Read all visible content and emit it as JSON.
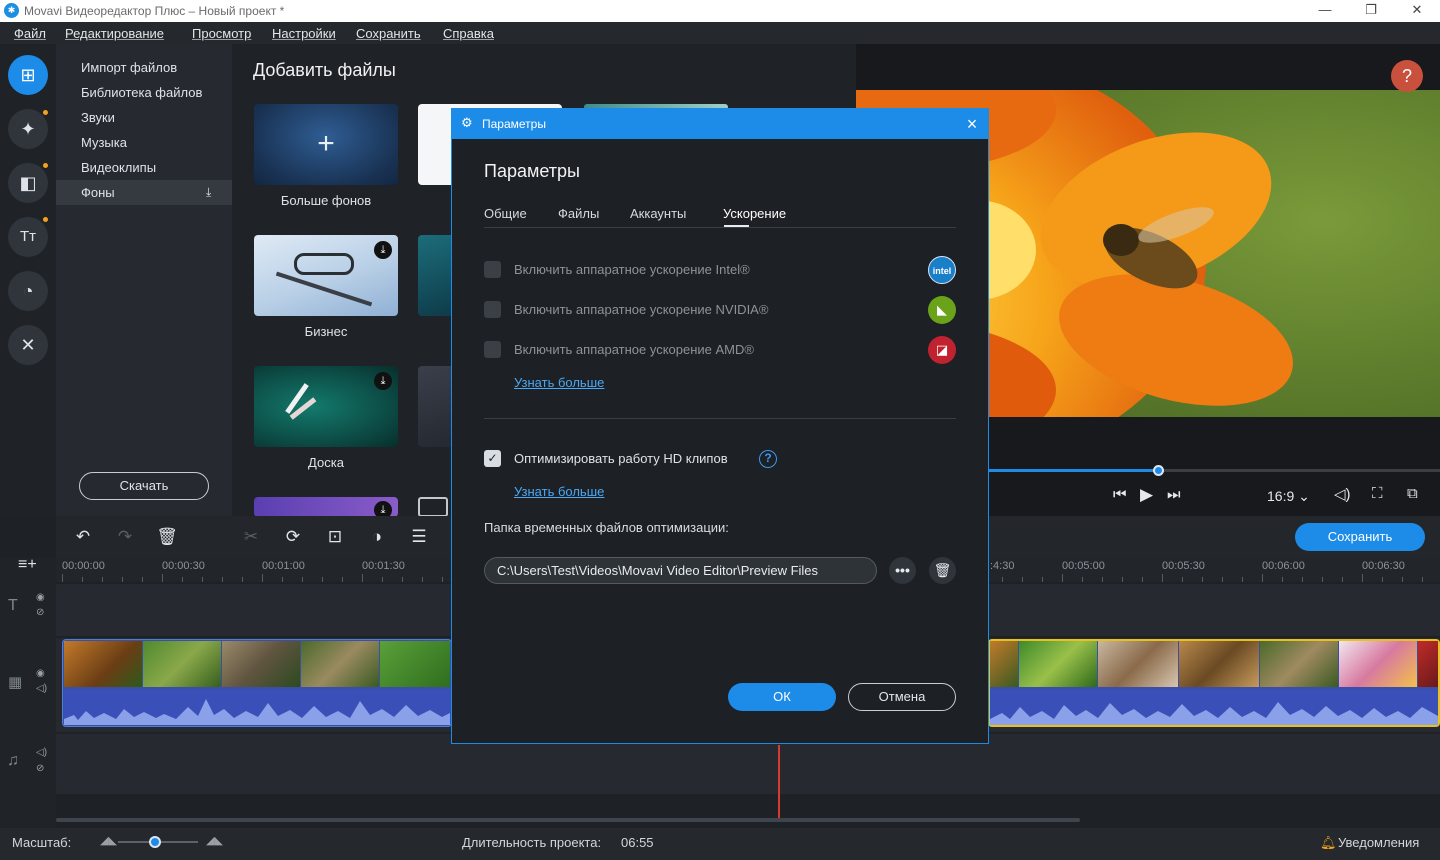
{
  "window": {
    "title": "Movavi Видеоредактор Плюс – Новый проект *",
    "logo_icon": "movavi-logo-icon",
    "controls": {
      "minimize": "—",
      "restore": "❐",
      "close": "✕"
    }
  },
  "menu": [
    "Файл",
    "Редактирование",
    "Просмотр",
    "Настройки",
    "Сохранить",
    "Справка"
  ],
  "rail": [
    {
      "icon": "import-icon",
      "glyph": "⊞",
      "active": true
    },
    {
      "icon": "magic-wand-icon",
      "glyph": "✦"
    },
    {
      "icon": "transitions-icon",
      "glyph": "◧"
    },
    {
      "icon": "titles-icon",
      "glyph": "Tт"
    },
    {
      "icon": "stickers-icon",
      "glyph": "◔"
    },
    {
      "icon": "tools-icon",
      "glyph": "✕"
    }
  ],
  "import_panel": {
    "items": [
      "Импорт файлов",
      "Библиотека файлов",
      "Звуки",
      "Музыка",
      "Видеоклипы",
      "Фоны"
    ],
    "active_item": "Фоны",
    "download_label": "Скачать"
  },
  "content": {
    "title": "Добавить файлы",
    "tiles": [
      {
        "label": "Больше фонов"
      },
      {
        "label": "Бизнес"
      },
      {
        "label": "Доска"
      }
    ]
  },
  "preview": {
    "help": "?",
    "aspect": "16:9",
    "progress": 0.378
  },
  "toolbar": {
    "save_label": "Сохранить"
  },
  "timeline": {
    "ticks": [
      "00:00:00",
      "00:00:30",
      "00:01:00",
      "00:01:30",
      ":4:30",
      "00:05:00",
      "00:05:30",
      "00:06:00",
      "00:06:30"
    ]
  },
  "status": {
    "zoom_label": "Масштаб:",
    "duration_label": "Длительность проекта:",
    "duration_value": "06:55",
    "notifications": "Уведомления"
  },
  "dialog": {
    "window_title": "Параметры",
    "heading": "Параметры",
    "tabs": [
      "Общие",
      "Файлы",
      "Аккаунты",
      "Ускорение"
    ],
    "active_tab": "Ускорение",
    "options": [
      {
        "label": "Включить аппаратное ускорение Intel®",
        "checked": false,
        "vendor": "intel"
      },
      {
        "label": "Включить аппаратное ускорение NVIDIA®",
        "checked": false,
        "vendor": "nvidia"
      },
      {
        "label": "Включить аппаратное ускорение AMD®",
        "checked": false,
        "vendor": "amd"
      }
    ],
    "vendor_marks": {
      "intel": "intel",
      "nvidia": "◣",
      "amd": "◪"
    },
    "learn_more_1": "Узнать больше",
    "hd_option": {
      "label": "Оптимизировать работу HD клипов",
      "checked": true
    },
    "learn_more_2": "Узнать больше",
    "folder_label": "Папка временных файлов оптимизации:",
    "folder_value": "C:\\Users\\Test\\Videos\\Movavi Video Editor\\Preview Files",
    "ok_label": "ОК",
    "cancel_label": "Отмена"
  },
  "colors": {
    "accent": "#1d8ce8",
    "help": "#c9503c",
    "playhead": "#d73a2f"
  }
}
